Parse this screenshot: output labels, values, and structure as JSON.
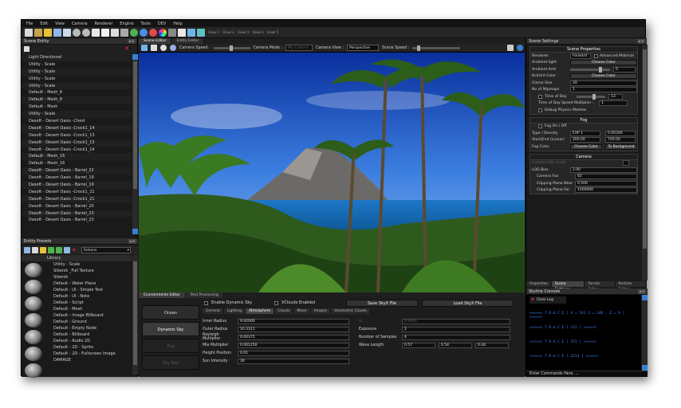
{
  "menu": [
    "File",
    "Edit",
    "View",
    "Camera",
    "Renderer",
    "Engine",
    "Tools",
    "DEV",
    "Help"
  ],
  "view_tabs": [
    "Viewl 1",
    "Viewl 2",
    "Viewl 3",
    "Viewl 4",
    "Viewl 5"
  ],
  "left": {
    "scene_entity_title": "Scene Entity",
    "entities": [
      "Light Directional",
      "Utility - Scale",
      "Utility - Scale",
      "Utility - Scale",
      "Utility - Scale",
      "Default - Mesh_8",
      "Default - Mesh_8",
      "Default - Mesh",
      "Utility - Scale",
      "Desoft - Desert Oasis -Chest",
      "Desoft - Desert Oasis -Crock1_14",
      "Desoft - Desert Oasis -Crock1_13",
      "Desoft - Desert Oasis -Crock1_13",
      "Desoft - Desert Oasis -Crock1_14",
      "Default - Mesh_16",
      "Default - Mesh_16",
      "Desoft - Desert Oasis - Barrel_22",
      "Desoft - Desert Oasis - Barrel_19",
      "Desoft - Desert Oasis - Barrel_19",
      "Desoft - Desert Oasis -Crock1_21",
      "Desoft - Desert Oasis -Crock1_21",
      "Desoft - Desert Oasis - Barrel_20",
      "Desoft - Desert Oasis - Barrel_23",
      "Desoft - Desert Oasis - Barrel_23"
    ],
    "presets_title": "Entity Presets",
    "actions_label": "Actions",
    "library_label": "Library",
    "presets": [
      "Utility - Scale",
      "Sibenik _Full Texture",
      "Sibenik",
      "Default - Water Plane",
      "Default - UI - Simple Text",
      "Default - UI - Note",
      "Default - Script",
      "Default - Mesh",
      "Default - Image Billboard",
      "Default - Ground",
      "Default - Empty Node",
      "Default - Billboard",
      "Default - Audio 2D",
      "Default - 2D - Sprite",
      "Default - 2D - Fullscreen Image",
      "DAMAGE"
    ]
  },
  "center": {
    "tabs": [
      "Scene Editor",
      "Entity Editor"
    ],
    "camera_speed_label": "Camera Speed :",
    "camera_mode_label": "Camera Mode :",
    "camera_mode_value": "My Camera",
    "camera_view_label": "Camera View :",
    "camera_view_value": "Perspective",
    "scene_speed_label": "Scene Speed :",
    "env_tabs": [
      "Environments Editor",
      "Post Processing"
    ],
    "side_buttons": [
      "Ocean",
      "Dynamic Sky",
      "Fog",
      "Sky Box"
    ],
    "enable_dynamic_sky": "Enable Dynamic Sky",
    "vclouds_enabled": "VClouds Enabled",
    "save_skyx": "Save SkyX File",
    "load_skyx": "Load SkyX File",
    "sub_tabs": [
      "General",
      "Lighting",
      "Atmosphere",
      "Clouds",
      "Moon",
      "Images",
      "Volumetric Clouds"
    ],
    "left_fields": [
      {
        "label": "Inner Radius",
        "value": "9.92000"
      },
      {
        "label": "Outer Radius",
        "value": "10.3311"
      },
      {
        "label": "Rayleigh Multiplier",
        "value": "0.00375"
      },
      {
        "label": "Mie Multiplier",
        "value": "0.001250"
      },
      {
        "label": "Height Position",
        "value": "0.01"
      },
      {
        "label": "Sun Intensity",
        "value": "30"
      }
    ],
    "right_fields": [
      {
        "label": "G",
        "value": "0.9965"
      },
      {
        "label": "Exposure",
        "value": "2"
      },
      {
        "label": "Number of Samples",
        "value": "4"
      }
    ],
    "wave_length_label": "Wave Length",
    "wave_length_values": [
      "0.57",
      "0.54",
      "0.44"
    ]
  },
  "right": {
    "title": "Scene Settings",
    "scene_props_header": "Scene Properties",
    "renderer_label": "Renderer",
    "renderer_value": "Forward",
    "advanced_material": "Advanced Material",
    "ambient_light": "Ambient light",
    "choose_color": "Choose Color",
    "ambient_amt": "Ambient Amt",
    "ambient_amt_value": "0",
    "bkgrd_color": "BckGrd Color",
    "gizmo_size": "Gizmo Size",
    "gizmo_size_value": "20",
    "mipmaps": "No of Mipmaps",
    "mipmaps_value": "1",
    "time_of_day": "Time of Day",
    "time_of_day_value": "13",
    "time_speed": "Time of Day Speed Multiplier :",
    "time_speed_value": "1",
    "debug_physics": "Debug Physics Meshes",
    "fog_header": "Fog",
    "fog_toggle": "Fog On / Off",
    "type_density": "Type / Density",
    "fog_type": "EXP 1",
    "fog_density": "0.00300",
    "start_end": "Start|End (Linear)",
    "fog_start": "200.00",
    "fog_end": "700.00",
    "fog_color": "Fog Color",
    "to_background": "To Background",
    "camera_header": "Camera",
    "camera_mode": "Camera Ede mode",
    "lod_bias": "LOD Bias",
    "lod_bias_value": "2.00",
    "camera_fov": "Camera Fov",
    "camera_fov_value": "82",
    "clip_near": "Clipping Plane Near",
    "clip_near_value": "0.500",
    "clip_far": "Clipping Plane Far",
    "clip_far_value": "1000000",
    "tabs": [
      "Properties",
      "Scene Settings",
      "Terrain Editor",
      "Particle Editor"
    ],
    "console_title": "Skyline Console",
    "clear_log": "Clear Log",
    "console_lines": [
      "<<<<<< T.R.A.C.E  [ X = 541.3 = 148 , Z = 0 ] >>>>>>",
      "<<<<<< T.R.A.C.E  [ 131 ] >>>>>>",
      "<<<<<< T.R.A.C.E  [ 151 ] >>>>>>",
      "<<<<<< T.R.A.C.E  [ 1214 ] >>>>>>"
    ],
    "enter_commands": "Enter Commands Here....."
  }
}
